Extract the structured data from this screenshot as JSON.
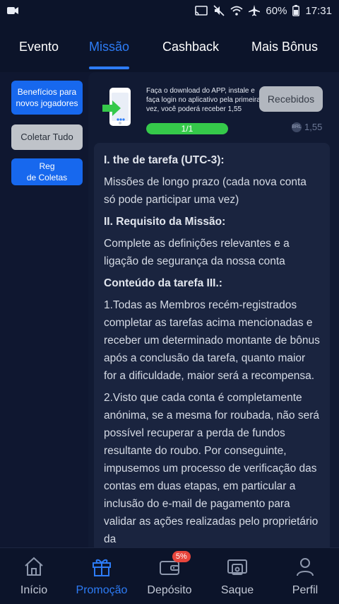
{
  "status_bar": {
    "battery": "60%",
    "time": "17:31",
    "icons": [
      "video-camera-icon",
      "cast-icon",
      "mute-icon",
      "wifi-icon",
      "airplane-icon",
      "battery-icon"
    ]
  },
  "tabs": [
    {
      "label": "Evento",
      "active": false
    },
    {
      "label": "Missão",
      "active": true
    },
    {
      "label": "Cashback",
      "active": false
    },
    {
      "label": "Mais Bônus",
      "active": false
    }
  ],
  "side_menu": {
    "new_players": "Benefícios para novos jogadores",
    "collect_all": "Coletar Tudo",
    "reg_line1": "Reg",
    "reg_line2": "de Coletas"
  },
  "task": {
    "description": "Faça o download do APP, instale e faça login no aplicativo pela primeira vez, você poderá receber 1,55",
    "progress_label": "1/1",
    "progress_fraction": 1.0,
    "claim_label": "Recebidos",
    "reward": "1,55",
    "coin_label": "BRL"
  },
  "rules": {
    "h1": "I. the de tarefa (UTC-3):",
    "p1": "Missões de longo prazo (cada nova conta só pode participar uma vez)",
    "h2": "II. Requisito da Missão:",
    "p2": "Complete as definições relevantes e a ligação de segurança da nossa conta",
    "h3": "Conteúdo da tarefa III.:",
    "p3": "1.Todas as Membros recém-registrados completar as tarefas acima mencionadas e receber um determinado montante de bônus após a conclusão da tarefa, quanto maior for a dificuldade, maior será a recompensa.",
    "p4": "2.Visto que cada conta é completamente anónima, se a mesma for roubada, não será possível recuperar a perda de fundos resultante do roubo. Por conseguinte, impusemos um processo de verificação das contas em duas etapas, em particular a inclusão do e-mail de pagamento para validar as ações realizadas pelo proprietário da"
  },
  "bottom_nav": [
    {
      "label": "Início",
      "icon": "home-icon",
      "active": false
    },
    {
      "label": "Promoção",
      "icon": "gift-icon",
      "active": true
    },
    {
      "label": "Depósito",
      "icon": "wallet-icon",
      "active": false,
      "badge": "5%"
    },
    {
      "label": "Saque",
      "icon": "withdraw-icon",
      "active": false
    },
    {
      "label": "Perfil",
      "icon": "profile-icon",
      "active": false
    }
  ],
  "colors": {
    "accent": "#2d7cf6",
    "background": "#0f1730",
    "progress": "#35c94a",
    "badge": "#e8453c"
  }
}
